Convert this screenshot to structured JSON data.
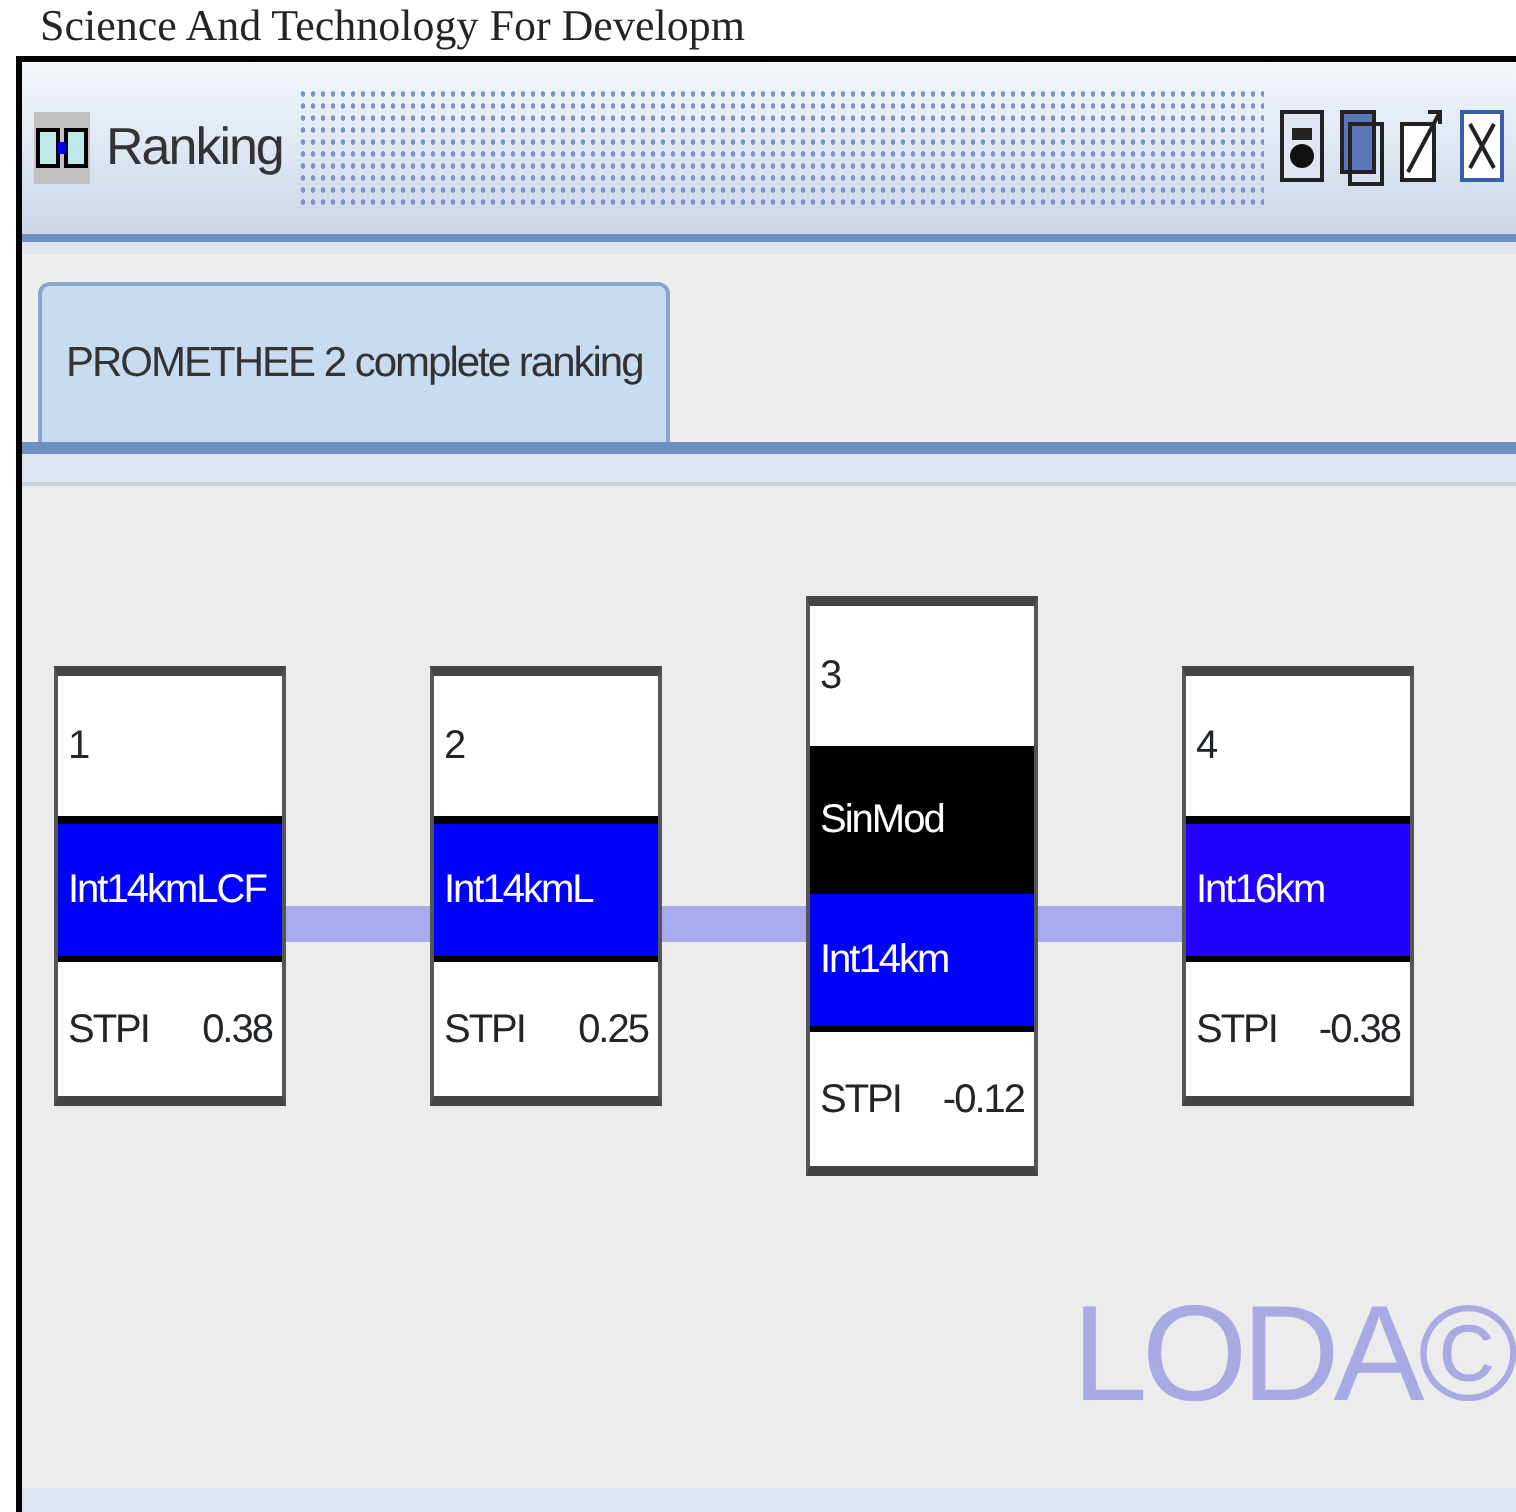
{
  "caption": "Science And Technology For Developm",
  "window": {
    "title": "Ranking"
  },
  "tabs": [
    {
      "label": "PROMETHEE 2 complete ranking",
      "selected": true
    }
  ],
  "ranking": [
    {
      "rank": "1",
      "alternatives": [
        {
          "name": "Int14kmLCF",
          "color": "#0000ff"
        }
      ],
      "metric": "STPI",
      "score": "0.38"
    },
    {
      "rank": "2",
      "alternatives": [
        {
          "name": "Int14kmL",
          "color": "#0000ff"
        }
      ],
      "metric": "STPI",
      "score": "0.25"
    },
    {
      "rank": "3",
      "alternatives": [
        {
          "name": "SinMod",
          "color": "#000000"
        },
        {
          "name": "Int14km",
          "color": "#0000ff"
        }
      ],
      "metric": "STPI",
      "score": "-0.12"
    },
    {
      "rank": "4",
      "alternatives": [
        {
          "name": "Int16km",
          "color": "#2200ff"
        }
      ],
      "metric": "STPI",
      "score": "-0.38"
    }
  ],
  "background_logo": "LODA©"
}
